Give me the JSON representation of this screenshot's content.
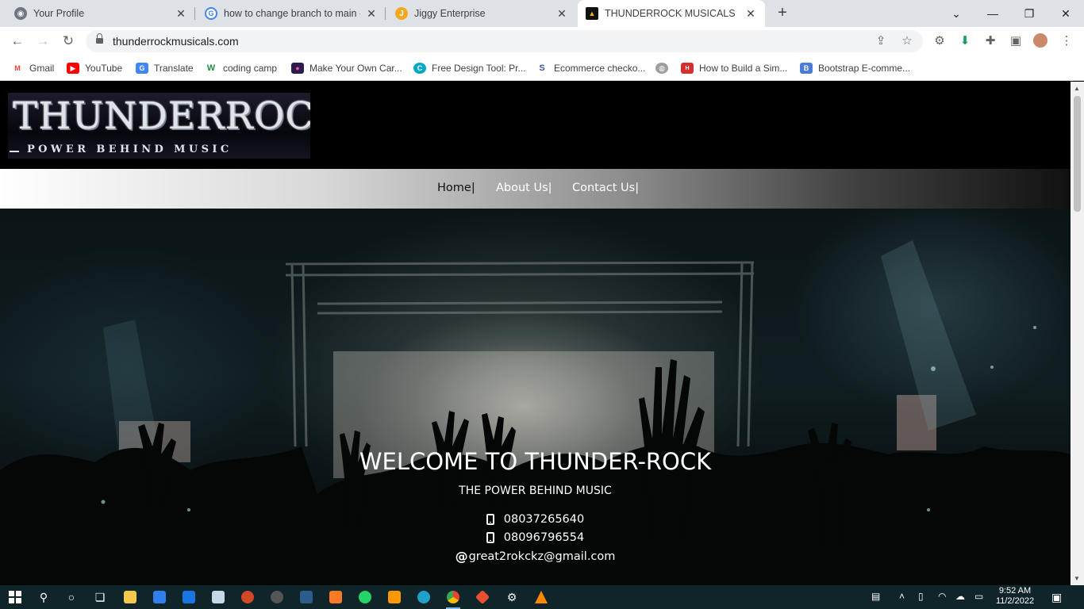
{
  "browser": {
    "tabs": [
      {
        "title": "Your Profile",
        "icon": "github-icon",
        "color": "#24292e"
      },
      {
        "title": "how to change branch to main -",
        "icon": "google-icon",
        "color": "#4285f4"
      },
      {
        "title": "Jiggy Enterprise",
        "icon": "jiggy-icon",
        "color": "#f4a81d"
      },
      {
        "title": "THUNDERROCK MUSICALS",
        "icon": "thunderrock-icon",
        "color": "#111111"
      }
    ],
    "url": "thunderrockmusicals.com",
    "bookmarks": [
      {
        "label": "Gmail",
        "icon": "gmail-icon",
        "color": "#ea4335",
        "glyph": "M"
      },
      {
        "label": "YouTube",
        "icon": "youtube-icon",
        "color": "#ff0000",
        "glyph": "▶"
      },
      {
        "label": "Translate",
        "icon": "translate-icon",
        "color": "#4285f4",
        "glyph": "G"
      },
      {
        "label": "coding camp",
        "icon": "coding-camp-icon",
        "color": "#1e8e3e",
        "glyph": "W"
      },
      {
        "label": "Make Your Own Car...",
        "icon": "flickr-icon",
        "color": "#6a1b9a",
        "glyph": "●"
      },
      {
        "label": "Free Design Tool: Pr...",
        "icon": "canva-icon",
        "color": "#00c4cc",
        "glyph": "C"
      },
      {
        "label": "Ecommerce checko...",
        "icon": "ecommerce-icon",
        "color": "#3b5998",
        "glyph": "S"
      },
      {
        "label": "",
        "icon": "globe-icon",
        "color": "#9e9e9e",
        "glyph": "◍"
      },
      {
        "label": "How to Build a Sim...",
        "icon": "hub-icon",
        "color": "#d32f2f",
        "glyph": "H"
      },
      {
        "label": "Bootstrap E-comme...",
        "icon": "bootstrap-icon",
        "color": "#4a7bd6",
        "glyph": "B"
      }
    ]
  },
  "site": {
    "logo": {
      "main": "THUNDERROCK",
      "tagline": "POWER BEHIND MUSIC"
    },
    "nav": [
      {
        "label": "Home|"
      },
      {
        "label": "About Us|"
      },
      {
        "label": "Contact Us|"
      }
    ],
    "hero": {
      "title": "WELCOME TO THUNDER-ROCK",
      "subtitle": "THE POWER BEHIND MUSIC",
      "phones": [
        "08037265640",
        "08096796554"
      ],
      "email": "great2rokckz@gmail.com"
    }
  },
  "taskbar": {
    "time": "9:52 AM",
    "date": "11/2/2022"
  }
}
